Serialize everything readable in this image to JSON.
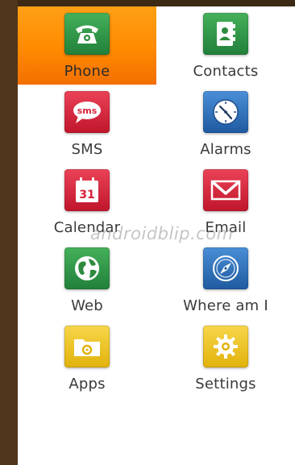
{
  "watermark": "androidblip.com",
  "apps": [
    {
      "label": "Phone",
      "icon": "phone-icon",
      "color": "#2e8b3e",
      "selected": true
    },
    {
      "label": "Contacts",
      "icon": "contacts-icon",
      "color": "#2e8b3e"
    },
    {
      "label": "SMS",
      "icon": "sms-icon",
      "color": "#d9213a",
      "icon_text": "sms"
    },
    {
      "label": "Alarms",
      "icon": "alarm-clock-icon",
      "color": "#2d6bb3"
    },
    {
      "label": "Calendar",
      "icon": "calendar-icon",
      "color": "#d9213a",
      "icon_text": "31"
    },
    {
      "label": "Email",
      "icon": "email-icon",
      "color": "#d9213a"
    },
    {
      "label": "Web",
      "icon": "globe-icon",
      "color": "#2e8b3e"
    },
    {
      "label": "Where am I",
      "icon": "compass-icon",
      "color": "#2d6bb3"
    },
    {
      "label": "Apps",
      "icon": "folder-icon",
      "color": "#f0c419"
    },
    {
      "label": "Settings",
      "icon": "gear-icon",
      "color": "#f0c419"
    }
  ]
}
